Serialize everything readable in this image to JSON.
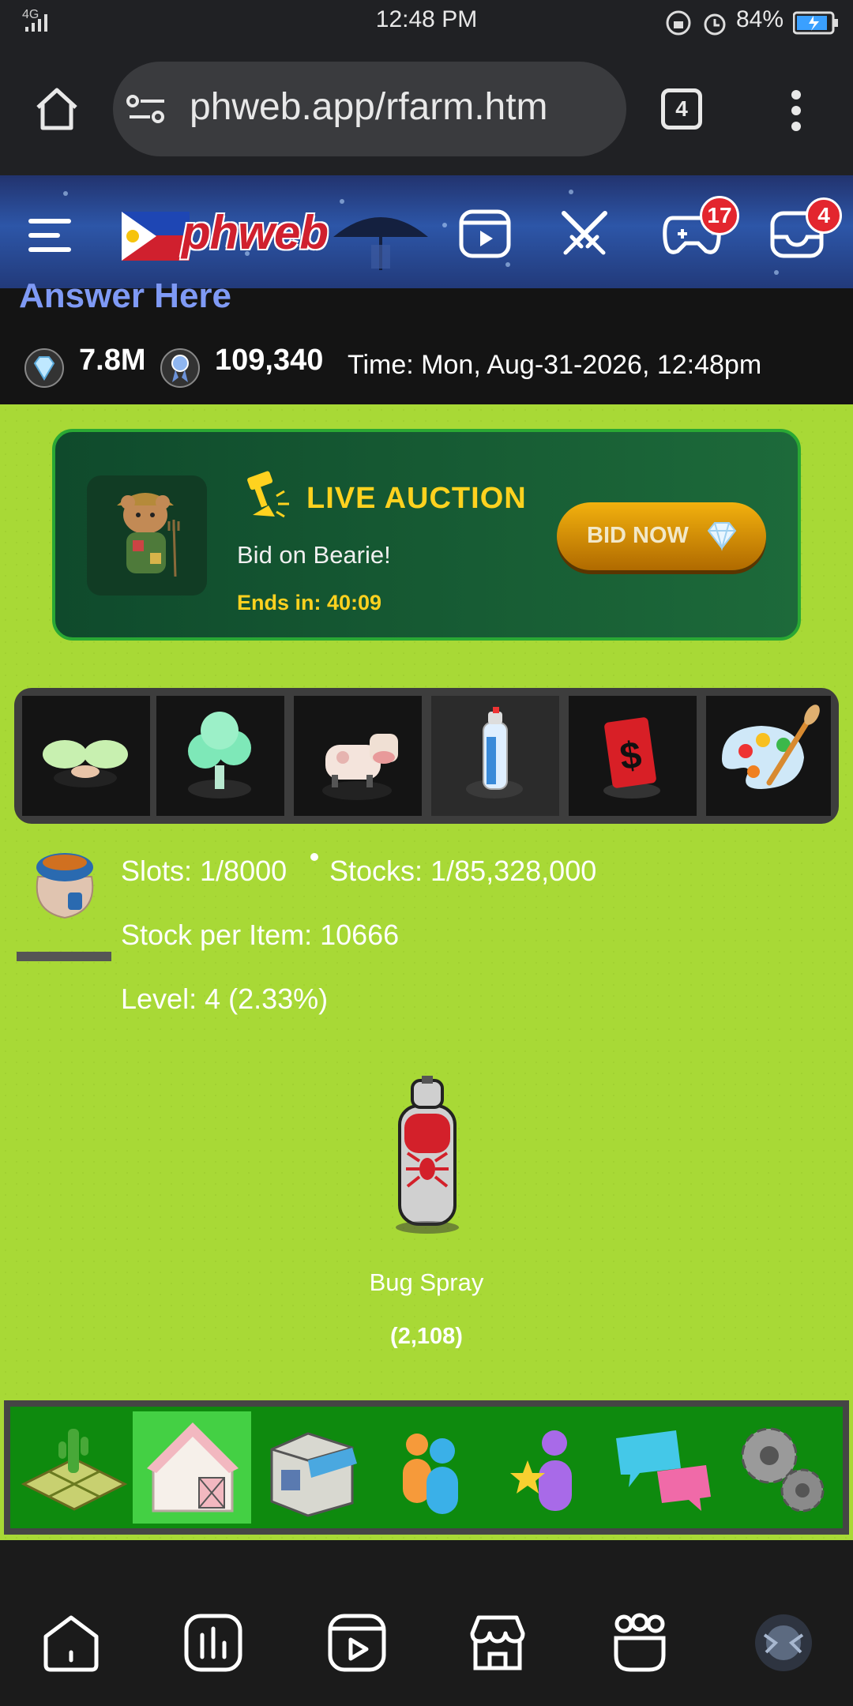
{
  "status_bar": {
    "signal": "4G",
    "time": "12:48 PM",
    "battery": "84%"
  },
  "browser": {
    "url": "phweb.app/rfarm.htm",
    "tab_count": "4"
  },
  "site_header": {
    "logo_text": "phweb",
    "game_badge": "17",
    "inbox_badge": "4"
  },
  "stats": {
    "answer_text": "Answer Here",
    "gems": "7.8M",
    "ribbons": "109,340",
    "time": "Time: Mon, Aug-31-2026, 12:48pm"
  },
  "auction": {
    "title": "LIVE AUCTION",
    "subtitle": "Bid on Bearie!",
    "ends": "Ends in: 40:09",
    "bid_label": "BID NOW"
  },
  "categories": [
    {
      "icon": "seedling-icon"
    },
    {
      "icon": "tree-icon"
    },
    {
      "icon": "cow-icon"
    },
    {
      "icon": "spray-can-icon",
      "selected": true
    },
    {
      "icon": "money-card-icon"
    },
    {
      "icon": "palette-icon"
    }
  ],
  "inventory": {
    "slots": "Slots: 1/8000",
    "stocks": "Stocks: 1/85,328,000",
    "stock_per_item": "Stock per Item: 10666",
    "level": "Level: 4 (2.33%)"
  },
  "item": {
    "name": "Bug Spray",
    "quantity": "(2,108)"
  },
  "game_nav": [
    {
      "icon": "farm-plot-icon"
    },
    {
      "icon": "barn-icon",
      "active": true
    },
    {
      "icon": "shop-icon"
    },
    {
      "icon": "friends-icon"
    },
    {
      "icon": "favorite-user-icon"
    },
    {
      "icon": "chat-icon"
    },
    {
      "icon": "settings-gears-icon"
    }
  ],
  "bottom_nav": [
    {
      "icon": "home-icon"
    },
    {
      "icon": "stats-icon"
    },
    {
      "icon": "video-icon"
    },
    {
      "icon": "store-icon"
    },
    {
      "icon": "groups-icon"
    },
    {
      "icon": "avatar"
    }
  ],
  "colors": {
    "grass": "#a8d936",
    "auction_bg": "#1d6a3a",
    "auction_accent": "#ffd21f",
    "game_nav_green": "#0e8a0e",
    "badge_red": "#e3262e"
  }
}
